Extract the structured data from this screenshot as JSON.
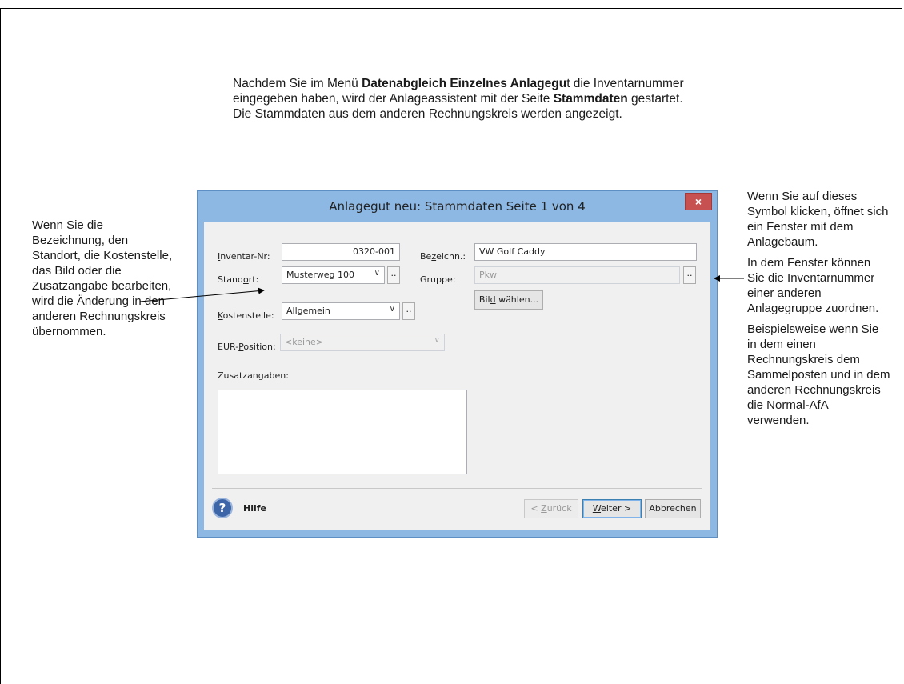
{
  "intro": {
    "p1": "Nachdem Sie im Menü ",
    "b1": "Datenabgleich Einzelnes Anlagegu",
    "p2": "t die Inventarnummer eingegeben haben, wird der Anlageassistent mit der Seite ",
    "b2": "Stammdaten",
    "p3": " gestartet. Die Stammdaten aus dem anderen Rechnungskreis werden angezeigt."
  },
  "note_left": "Wenn Sie die Bezeichnung, den Standort, die Kostenstelle, das Bild oder die Zusatzangabe bearbeiten, wird die Änderung in den anderen Rechnungskreis übernommen.",
  "note_right": {
    "p1": "Wenn Sie auf dieses Symbol klicken, öffnet sich ein Fenster mit dem Anlagebaum.",
    "p2": "In dem Fenster können Sie die Inventarnummer einer anderen Anlagegruppe zuordnen.",
    "p3": "Beispielsweise wenn Sie in dem einen Rechnungskreis dem Sammelposten und in dem anderen Rechnungskreis die Normal-AfA verwenden."
  },
  "dialog": {
    "title": "Anlagegut neu: Stammdaten Seite 1 von 4",
    "close": "×",
    "inventar_label_u": "I",
    "inventar_label_rest": "nventar-Nr:",
    "inventar_value": "0320-001",
    "bezeichn_label_a": "Be",
    "bezeichn_label_u": "z",
    "bezeichn_label_rest": "eichn.:",
    "bezeichn_value": "VW Golf Caddy",
    "standort_label_a": "Stand",
    "standort_label_u": "o",
    "standort_label_rest": "rt:",
    "standort_value": "Musterweg 100",
    "gruppe_label": "Gruppe:",
    "gruppe_value": "Pkw",
    "bild_a": "Bil",
    "bild_u": "d",
    "bild_rest": " wählen...",
    "kostenstelle_label_u": "K",
    "kostenstelle_label_rest": "ostenstelle:",
    "kostenstelle_value": "Allgemein",
    "eur_label_a": "EÜR-",
    "eur_label_u": "P",
    "eur_label_rest": "osition:",
    "eur_value": "<keine>",
    "zusatz_label": "Zusatzangaben:",
    "dots": "..",
    "arrow": "∨",
    "help_icon": "?",
    "help_label": "Hilfe",
    "back_a": "< ",
    "back_u": "Z",
    "back_rest": "urück",
    "next_u": "W",
    "next_rest": "eiter >",
    "cancel": "Abbrechen"
  }
}
